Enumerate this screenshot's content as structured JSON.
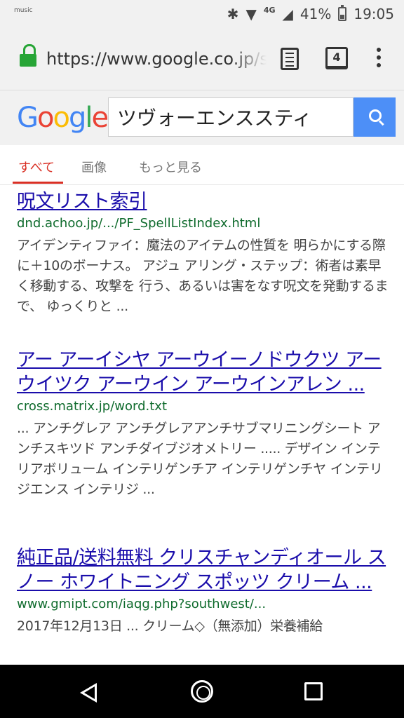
{
  "status": {
    "music_label": "music",
    "network": "4G",
    "battery": "41%",
    "time": "19:05"
  },
  "browser": {
    "url": "https://www.google.co.jp/search",
    "tab_count": "4"
  },
  "search": {
    "logo": "Google",
    "query": "ツヴォーエンススティ",
    "logo_colors": [
      "#4285f4",
      "#ea4335",
      "#fbbc05",
      "#4285f4",
      "#34a853",
      "#ea4335"
    ]
  },
  "tabs": [
    {
      "label": "すべて",
      "active": true
    },
    {
      "label": "画像",
      "active": false
    },
    {
      "label": "もっと見る",
      "active": false
    }
  ],
  "results": [
    {
      "title": "呪文リスト索引",
      "url": "dnd.achoo.jp/.../PF_SpellListIndex.html",
      "snippet": "アイデンティファイ：魔法のアイテムの性質を 明らかにする際に＋10のボーナス。 アジュ アリング・ステップ：術者は素早く移動する、攻撃を 行う、あるいは害をなす呪文を発動するまで、 ゆっくりと ..."
    },
    {
      "title": "アー アーイシヤ アーウイーノドウクツ アーウイツク アーウイン アーウインアレン ...",
      "url": "cross.matrix.jp/word.txt",
      "snippet": "... アンチグレア アンチグレアアンチサブマリニングシート アンチスキツド アンチダイブジオメトリー ..... デザイン インテリアボリューム インテリゲンチア インテリゲンチヤ インテリジエンス インテリジ ..."
    },
    {
      "title": "純正品/送料無料 クリスチャンディオール スノー ホワイトニング スポッツ クリーム ...",
      "url": "www.gmipt.com/iaqg.php?southwest/...",
      "snippet": "2017年12月13日 ... クリーム◇（無添加）栄養補給"
    }
  ]
}
